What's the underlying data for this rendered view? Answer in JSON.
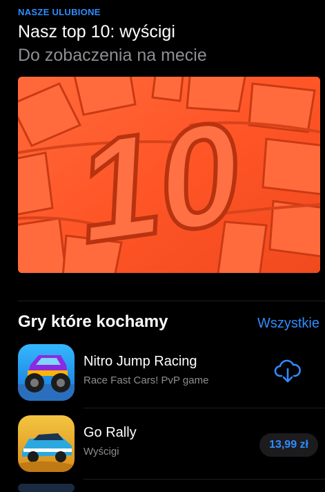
{
  "feature": {
    "eyebrow": "NASZE ULUBIONE",
    "title": "Nasz top 10: wyścigi",
    "subtitle": "Do zobaczenia na mecie",
    "hero_number": "10"
  },
  "section": {
    "title": "Gry które kochamy",
    "see_all": "Wszystkie"
  },
  "apps": [
    {
      "name": "Nitro Jump Racing",
      "subtitle": "Race Fast Cars! PvP game",
      "action": "download",
      "icon": "monster-truck-icon"
    },
    {
      "name": "Go Rally",
      "subtitle": "Wyścigi",
      "price": "13,99 zł",
      "icon": "rally-car-icon"
    }
  ],
  "colors": {
    "accent": "#2f8cff",
    "background": "#000000",
    "hero": "#ff5a2d"
  }
}
